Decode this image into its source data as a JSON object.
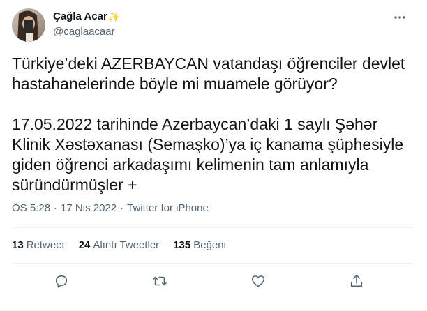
{
  "tweet": {
    "author_name": "Çağla Acar",
    "author_emoji": "✨",
    "handle": "@caglaacaar",
    "more_icon": "more-dots-icon",
    "text": "Türkiye’deki AZERBAYCAN vatandaşı öğrenciler devlet hastahanelerinde böyle mi muamele görüyor?\n\n17.05.2022 tarihinde Azerbaycan’daki 1 saylı Şəhər Klinik Xəstəxanası (Semaşko)’ya iç kanama şüphesiyle giden öğrenci arkadaşımı kelimenin tam anlamıyla süründürmüşler +",
    "time": "ÖS 5:28",
    "date": "17 Nis 2022",
    "source": "Twitter for iPhone",
    "separator": "·"
  },
  "stats": {
    "retweets_count": "13",
    "retweets_label": "Retweet",
    "quotes_count": "24",
    "quotes_label": "Alıntı Tweetler",
    "likes_count": "135",
    "likes_label": "Beğeni"
  },
  "actions": [
    {
      "name": "reply",
      "icon": "reply-icon"
    },
    {
      "name": "retweet",
      "icon": "retweet-icon"
    },
    {
      "name": "like",
      "icon": "heart-icon"
    },
    {
      "name": "share",
      "icon": "share-icon"
    }
  ],
  "colors": {
    "text_primary": "#0f1419",
    "text_secondary": "#536471",
    "divider": "#eff3f4",
    "icon": "#536471"
  }
}
